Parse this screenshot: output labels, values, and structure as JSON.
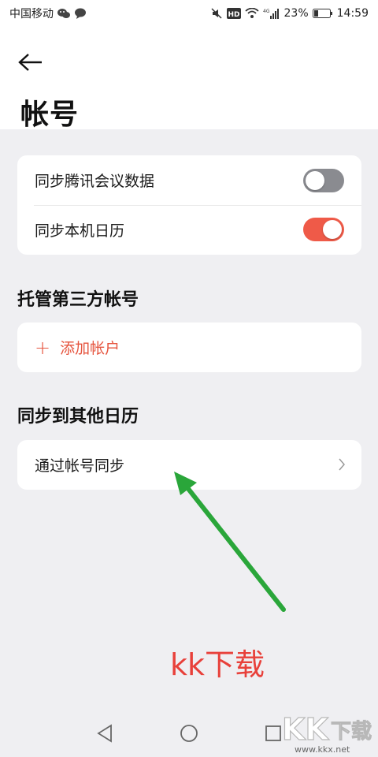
{
  "status_bar": {
    "carrier": "中国移动",
    "battery": "23%",
    "time": "14:59",
    "network": "4G",
    "hd": "HD"
  },
  "header": {
    "back_icon": "arrow-left-icon",
    "title": "帐号"
  },
  "sync_card": {
    "items": [
      {
        "label": "同步腾讯会议数据",
        "toggle_on": false
      },
      {
        "label": "同步本机日历",
        "toggle_on": true
      }
    ]
  },
  "third_party": {
    "title": "托管第三方帐号",
    "add_label": "添加帐户"
  },
  "other_calendars": {
    "title": "同步到其他日历",
    "item_label": "通过帐号同步"
  },
  "annotation": {
    "text": "kk下载"
  },
  "watermark": {
    "url": "www.kkx.net"
  },
  "colors": {
    "accent": "#ef5a48",
    "toggle_off": "#8a8b90",
    "arrow_green": "#2aa63a"
  }
}
